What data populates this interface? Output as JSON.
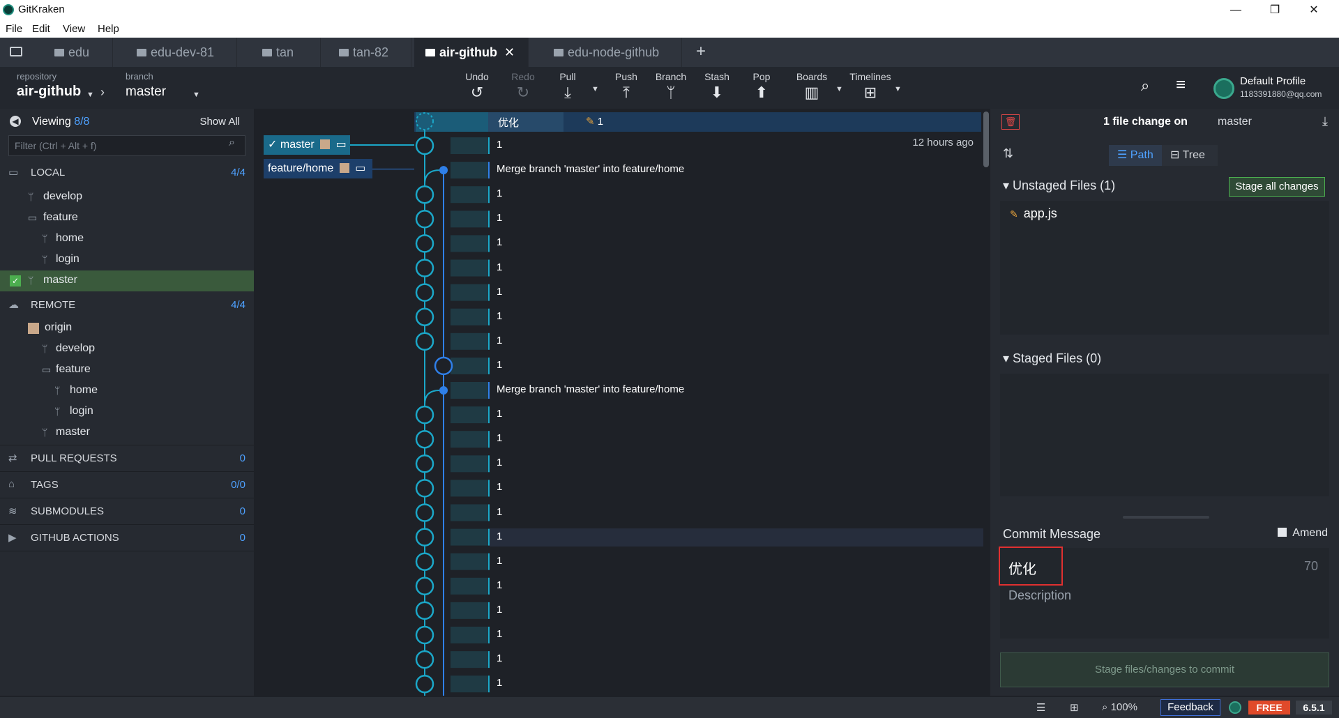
{
  "window": {
    "title": "GitKraken",
    "menu": [
      "File",
      "Edit",
      "View",
      "Help"
    ],
    "controls": [
      "—",
      "❐",
      "✕"
    ]
  },
  "tabs": [
    {
      "label": "edu",
      "active": false
    },
    {
      "label": "edu-dev-81",
      "active": false
    },
    {
      "label": "tan",
      "active": false
    },
    {
      "label": "tan-82",
      "active": false
    },
    {
      "label": "air-github",
      "active": true
    },
    {
      "label": "edu-node-github",
      "active": false
    }
  ],
  "tab_close": "✕",
  "tab_add": "+",
  "toolbar": {
    "repo_label": "repository",
    "repo_name": "air-github",
    "branch_label": "branch",
    "branch_name": "master",
    "buttons": [
      {
        "label": "Undo",
        "icon": "undo-icon",
        "glyph": "↺",
        "disabled": false
      },
      {
        "label": "Redo",
        "icon": "redo-icon",
        "glyph": "↻",
        "disabled": true
      },
      {
        "label": "Pull",
        "icon": "pull-icon",
        "glyph": "⤓",
        "disabled": false
      },
      {
        "label": "Push",
        "icon": "push-icon",
        "glyph": "⤒",
        "disabled": false
      },
      {
        "label": "Branch",
        "icon": "branch-icon",
        "glyph": "ᛘ",
        "disabled": false
      },
      {
        "label": "Stash",
        "icon": "stash-icon",
        "glyph": "⬇",
        "disabled": false
      },
      {
        "label": "Pop",
        "icon": "pop-icon",
        "glyph": "⬆",
        "disabled": false
      },
      {
        "label": "Boards",
        "icon": "boards-icon",
        "glyph": "▥",
        "disabled": false
      },
      {
        "label": "Timelines",
        "icon": "timelines-icon",
        "glyph": "⊞",
        "disabled": false
      }
    ],
    "profile_name": "Default Profile",
    "profile_email": "1183391880@qq.com"
  },
  "left": {
    "viewing_label": "Viewing",
    "viewing_count": "8/8",
    "show_all": "Show All",
    "filter_placeholder": "Filter (Ctrl + Alt + f)",
    "local_label": "LOCAL",
    "local_count": "4/4",
    "local_items": [
      "develop",
      "feature",
      "home",
      "login",
      "master"
    ],
    "remote_label": "REMOTE",
    "remote_count": "4/4",
    "remote_items": [
      "origin",
      "develop",
      "feature",
      "home",
      "login",
      "master"
    ],
    "pull_requests_label": "PULL REQUESTS",
    "pull_requests_count": "0",
    "tags_label": "TAGS",
    "tags_count": "0/0",
    "submodules_label": "SUBMODULES",
    "submodules_count": "0",
    "actions_label": "GITHUB ACTIONS",
    "actions_count": "0"
  },
  "graph": {
    "wip_message": "优化",
    "wip_changes": "1",
    "branch_tags": [
      "master",
      "feature/home"
    ],
    "time_ago": "12 hours ago",
    "rows": [
      "1",
      "Merge branch 'master' into feature/home",
      "1",
      "1",
      "1",
      "1",
      "1",
      "1",
      "1",
      "1",
      "Merge branch 'master' into feature/home",
      "1",
      "1",
      "1",
      "1",
      "1",
      "1",
      "1",
      "1",
      "1",
      "1",
      "1",
      "1"
    ],
    "colors": {
      "master": "#1ba7c8",
      "feature": "#2f7fe8"
    }
  },
  "right": {
    "change_title": "1 file change on",
    "change_branch": "master",
    "path_label": "Path",
    "tree_label": "Tree",
    "unstaged_label": "Unstaged Files (1)",
    "stage_all": "Stage all changes",
    "unstaged_files": [
      "app.js"
    ],
    "staged_label": "Staged Files (0)",
    "commit_message_label": "Commit Message",
    "amend_label": "Amend",
    "summary_value": "优化",
    "char_count": "70",
    "description_placeholder": "Description",
    "commit_button": "Stage files/changes to commit"
  },
  "status": {
    "zoom": "100%",
    "feedback": "Feedback",
    "plan": "FREE",
    "version": "6.5.1"
  }
}
